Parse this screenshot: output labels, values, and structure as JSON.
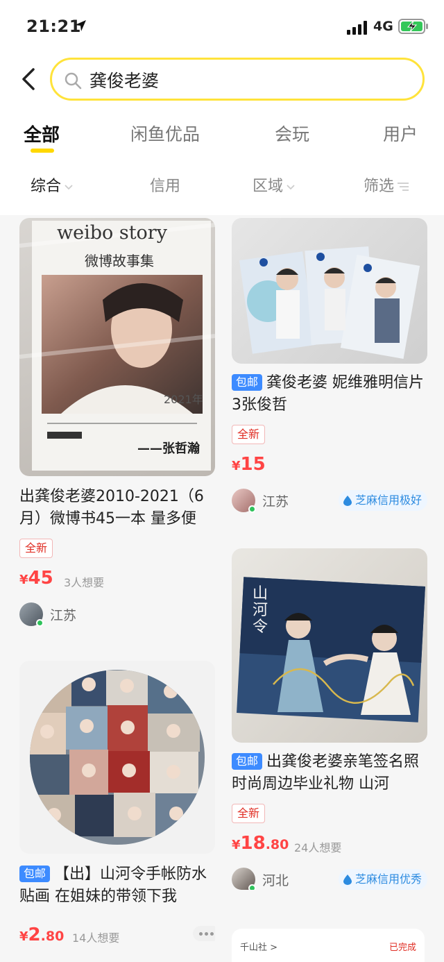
{
  "status_bar": {
    "time": "21:21",
    "network": "4G"
  },
  "search": {
    "query": "龚俊老婆"
  },
  "tabs": [
    {
      "label": "全部",
      "active": true
    },
    {
      "label": "闲鱼优品"
    },
    {
      "label": "会玩"
    },
    {
      "label": "用户"
    }
  ],
  "filters": [
    {
      "label": "综合",
      "active": true
    },
    {
      "label": "信用"
    },
    {
      "label": "区域"
    },
    {
      "label": "筛选"
    }
  ],
  "products": [
    {
      "image_caption_top": "weibo story",
      "image_caption_sub": "微博故事集",
      "image_caption_year": "2021年",
      "image_caption_sign": "——张哲瀚",
      "title": "出龚俊老婆2010-2021（6月）微博书45一本 量多便",
      "new_tag": "全新",
      "price_symbol": "¥",
      "price": "45",
      "want": "3人想要",
      "location": "江苏"
    },
    {
      "badge": "包邮",
      "title": "龚俊老婆 妮维雅明信片3张俊哲",
      "new_tag": "全新",
      "price_symbol": "¥",
      "price": "15",
      "location": "江苏",
      "credit": "芝麻信用极好"
    },
    {
      "image_caption": "山河令",
      "badge": "包邮",
      "title": "出龚俊老婆亲笔签名照时尚周边毕业礼物 山河",
      "new_tag": "全新",
      "price_symbol": "¥",
      "price_int": "18",
      "price_dec": ".80",
      "want": "24人想要",
      "location": "河北",
      "credit": "芝麻信用优秀"
    },
    {
      "badge": "包邮",
      "title": "【出】山河令手帐防水贴画 在姐妹的带领下我",
      "price_symbol": "¥",
      "price_int": "2",
      "price_dec": ".80",
      "want": "14人想要"
    }
  ],
  "peek_card": {
    "shop": "千山社 >",
    "status": "已完成"
  },
  "colors": {
    "accent_yellow": "#ffe33b",
    "price_red": "#ff4444",
    "badge_blue": "#3d8bff",
    "credit_blue": "#2c8be0"
  }
}
